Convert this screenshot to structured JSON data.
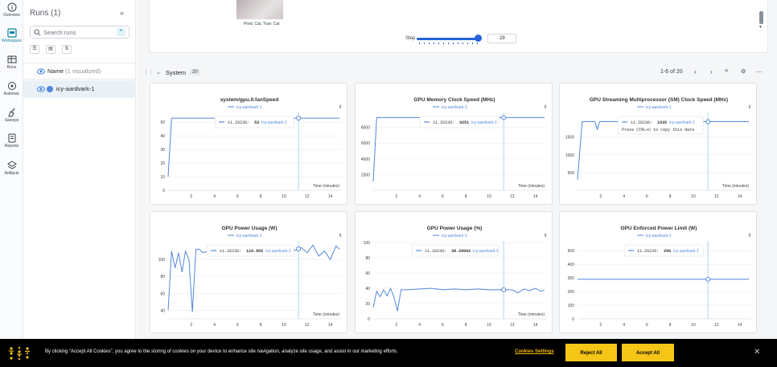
{
  "sidebar": {
    "items": [
      {
        "label": "Overview"
      },
      {
        "label": "Workspace"
      },
      {
        "label": "Runs"
      },
      {
        "label": "Automat."
      },
      {
        "label": "Sweeps"
      },
      {
        "label": "Reports"
      },
      {
        "label": "Artifacts"
      }
    ]
  },
  "runs_panel": {
    "title": "Runs (1)",
    "search_placeholder": "Search runs",
    "header_label": "Name",
    "header_sub": "(1 visualized)",
    "run_name": "icy-aardvark-1",
    "run_color": "#5387dd"
  },
  "media_panel": {
    "caption": "Pred: Cat, True: Cat",
    "step_label": "Step",
    "step_value": "29"
  },
  "section": {
    "title": "System",
    "count": "20",
    "pager": "1-6 of 20"
  },
  "charts": [
    {
      "title": "system/gpu.0.fanSpeed",
      "legend": "icy-aardvark-1",
      "tooltip_x": "11.26236",
      "tooltip_val": "53",
      "tooltip_run": "icy-aardvark-1",
      "xlabel": "Time (minutes)"
    },
    {
      "title": "GPU Memory Clock Speed (MHz)",
      "legend": "icy-aardvark-1",
      "tooltip_x": "11.26236",
      "tooltip_val": "9251",
      "tooltip_run": "icy-aardvark-1",
      "xlabel": "Time (minutes)"
    },
    {
      "title": "GPU Streaming Multiprocessor (SM) Clock Speed (MHz)",
      "legend": "icy-aardvark-1",
      "tooltip_x": "11.26236",
      "tooltip_val": "1935",
      "tooltip_run": "icy-aardvark-1",
      "tooltip_hint": "Press CTRL+C to copy this data",
      "xlabel": "Time (minutes)"
    },
    {
      "title": "GPU Power Usage (W)",
      "legend": "icy-aardvark-1",
      "tooltip_x": "11.26236",
      "tooltip_val": "110.865",
      "tooltip_run": "icy-aardvark-1",
      "xlabel": "Time (minutes)"
    },
    {
      "title": "GPU Power Usage (%)",
      "legend": "icy-aardvark-1",
      "tooltip_x": "11.26236",
      "tooltip_val": "38.28062",
      "tooltip_run": "icy-aardvark-1",
      "xlabel": "Time (minutes)"
    },
    {
      "title": "GPU Enforced Power Limit (W)",
      "legend": "icy-aardvark-1",
      "tooltip_x": "11.26236",
      "tooltip_val": "290",
      "tooltip_run": "icy-aardvark-1",
      "xlabel": ""
    }
  ],
  "chart_data": [
    {
      "type": "line",
      "title": "system/gpu.0.fanSpeed",
      "xlabel": "Time (minutes)",
      "xlim": [
        0,
        15
      ],
      "ylim": [
        0,
        56
      ],
      "xticks": [
        2,
        4,
        6,
        8,
        10,
        12,
        14
      ],
      "yticks": [
        0,
        10,
        20,
        30,
        40,
        50
      ],
      "series": [
        {
          "name": "icy-aardvark-1",
          "x": [
            0,
            0.3,
            14.8
          ],
          "y": [
            10,
            53,
            53
          ]
        }
      ],
      "hover_x": 11.26
    },
    {
      "type": "line",
      "title": "GPU Memory Clock Speed (MHz)",
      "xlabel": "Time (minutes)",
      "xlim": [
        0,
        15
      ],
      "ylim": [
        0,
        9700
      ],
      "xticks": [
        2,
        4,
        6,
        8,
        10,
        12,
        14
      ],
      "yticks": [
        2000,
        4000,
        6000,
        8000
      ],
      "series": [
        {
          "name": "icy-aardvark-1",
          "x": [
            0,
            0.3,
            14.8
          ],
          "y": [
            1100,
            9251,
            9251
          ]
        }
      ],
      "hover_x": 11.26
    },
    {
      "type": "line",
      "title": "GPU Streaming Multiprocessor (SM) Clock Speed (MHz)",
      "xlabel": "Time (minutes)",
      "xlim": [
        0,
        15
      ],
      "ylim": [
        0,
        2150
      ],
      "xticks": [
        2,
        4,
        6,
        8,
        10,
        12,
        14
      ],
      "yticks": [
        500,
        1000,
        1500
      ],
      "series": [
        {
          "name": "icy-aardvark-1",
          "x": [
            0,
            0.4,
            1.5,
            1.7,
            1.9,
            2.1,
            14.8
          ],
          "y": [
            300,
            1935,
            1935,
            1720,
            1935,
            1935,
            1935
          ]
        }
      ],
      "hover_x": 11.26
    },
    {
      "type": "line",
      "title": "GPU Power Usage (W)",
      "xlabel": "Time (minutes)",
      "xlim": [
        0,
        15
      ],
      "ylim": [
        30,
        120
      ],
      "xticks": [
        2,
        4,
        6,
        8,
        10,
        12,
        14
      ],
      "yticks": [
        40,
        60,
        80,
        100
      ],
      "series": [
        {
          "name": "icy-aardvark-1",
          "x": [
            0,
            0.3,
            0.6,
            0.9,
            1.2,
            1.5,
            1.8,
            2.1,
            2.4,
            2.7,
            3.0,
            3.5,
            4,
            5,
            6,
            7,
            8,
            9,
            10,
            11,
            11.5,
            12,
            12.5,
            13,
            13.5,
            14,
            14.5,
            14.8
          ],
          "y": [
            40,
            110,
            90,
            108,
            85,
            110,
            100,
            38,
            112,
            112,
            108,
            110,
            109,
            110,
            108,
            109,
            110,
            109,
            110,
            111,
            114,
            108,
            117,
            104,
            110,
            100,
            116,
            112
          ]
        }
      ],
      "hover_x": 11.26
    },
    {
      "type": "line",
      "title": "GPU Power Usage (%)",
      "xlabel": "Time (minutes)",
      "xlim": [
        0,
        15
      ],
      "ylim": [
        0,
        100
      ],
      "xticks": [
        2,
        4,
        6,
        8,
        10,
        12,
        14
      ],
      "yticks": [
        0,
        20,
        40,
        60,
        80,
        100
      ],
      "series": [
        {
          "name": "icy-aardvark-1",
          "x": [
            0,
            0.3,
            0.6,
            0.9,
            1.2,
            1.5,
            1.8,
            2.1,
            2.4,
            3,
            4,
            5,
            6,
            7,
            8,
            9,
            10,
            11,
            12,
            12.5,
            13,
            13.5,
            14,
            14.5,
            14.8
          ],
          "y": [
            15,
            36,
            29,
            38,
            30,
            40,
            28,
            10,
            38,
            38,
            39,
            40,
            38,
            39,
            38,
            39,
            38,
            38,
            38,
            34,
            39,
            37,
            40,
            36,
            38
          ]
        }
      ],
      "hover_x": 11.26
    },
    {
      "type": "line",
      "title": "GPU Enforced Power Limit (W)",
      "xlabel": "",
      "xlim": [
        0,
        15
      ],
      "ylim": [
        0,
        560
      ],
      "xticks": [
        2,
        4,
        6,
        8,
        10,
        12,
        14
      ],
      "yticks": [
        0,
        100,
        200,
        300,
        400,
        500
      ],
      "series": [
        {
          "name": "icy-aardvark-1",
          "x": [
            0,
            14.8
          ],
          "y": [
            290,
            290
          ]
        }
      ],
      "hover_x": 11.26
    }
  ],
  "cookie": {
    "message": "By clicking “Accept All Cookies”, you agree to the storing of cookies on your device to enhance site navigation, analyze site usage, and assist in our marketing efforts.",
    "settings": "Cookies Settings",
    "reject": "Reject All",
    "accept": "Accept All"
  },
  "colors": {
    "accent": "#0f7fa1",
    "series": "#5387dd",
    "banner": "#f5c518"
  }
}
